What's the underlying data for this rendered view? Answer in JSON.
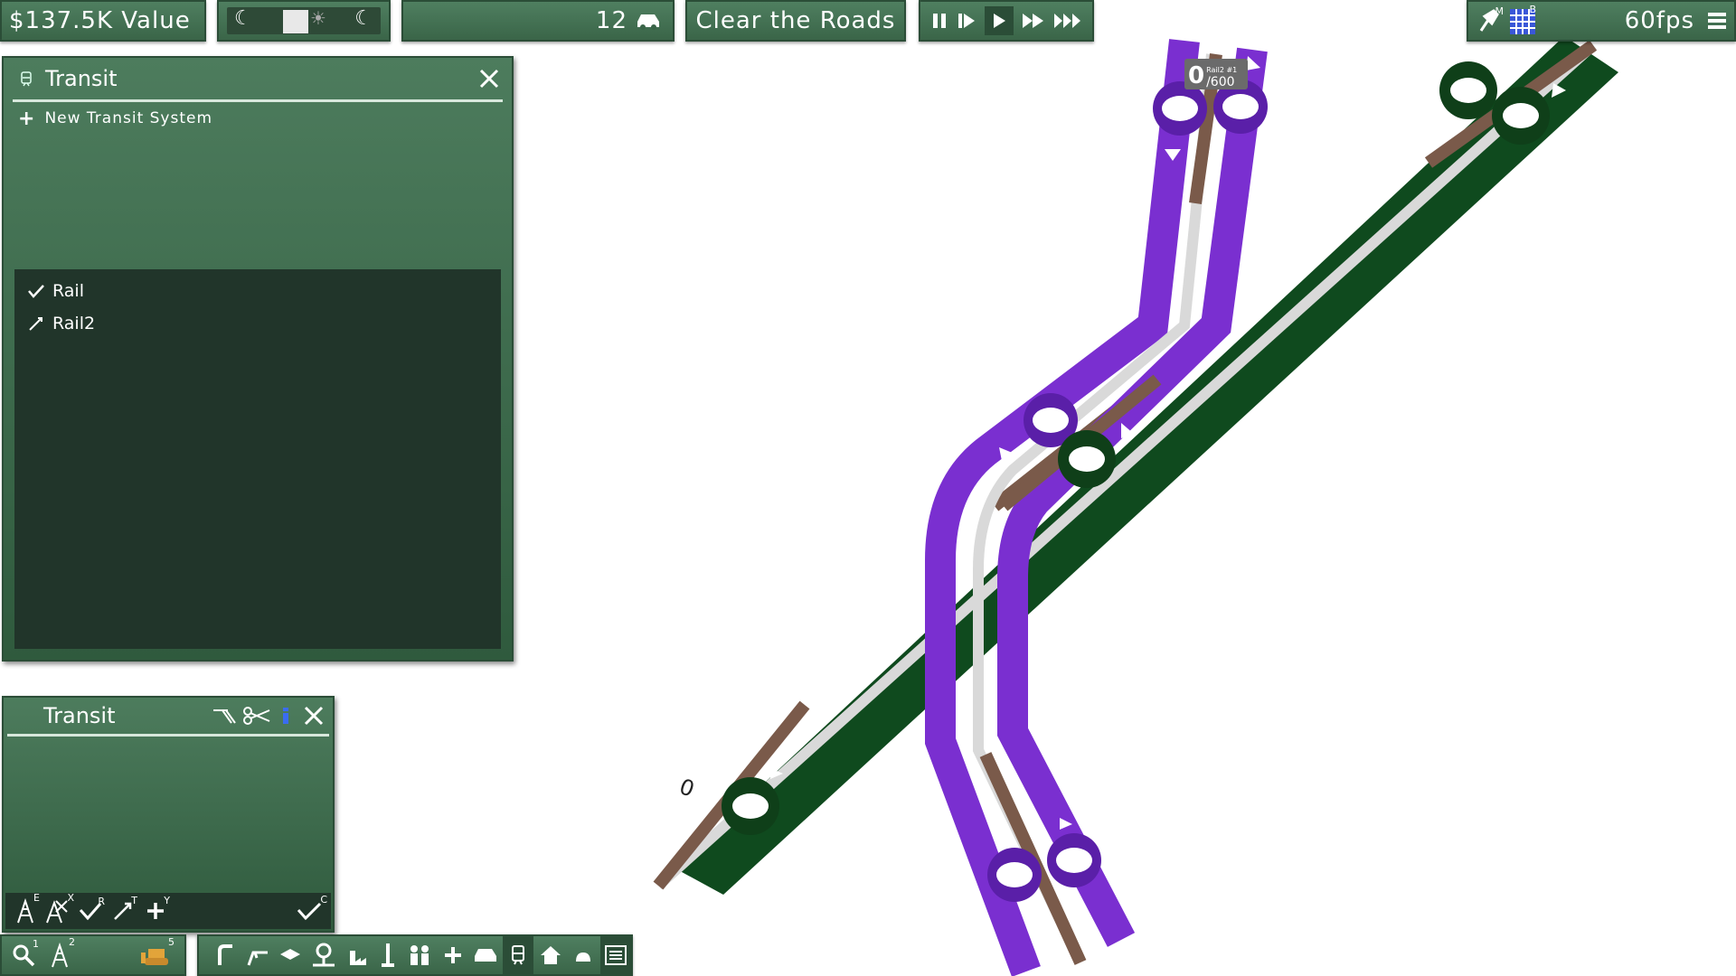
{
  "topbar": {
    "value_text": "$137.5K Value",
    "vehicle_count": "12",
    "clear_roads": "Clear the Roads",
    "fps": "60fps",
    "hotkeys": {
      "pin": "M",
      "grid": "B"
    }
  },
  "transit_panel": {
    "title": "Transit",
    "new_system": "New Transit System",
    "systems": [
      {
        "label": "Rail",
        "state": "check"
      },
      {
        "label": "Rail2",
        "state": "edit"
      }
    ]
  },
  "transit_tool": {
    "title": "Transit",
    "hotkeys": {
      "build": "E",
      "remove": "X",
      "done": "R",
      "edit": "T",
      "add": "Y",
      "confirm": "C"
    }
  },
  "bottom_left": {
    "hotkeys": {
      "search": "1",
      "road": "2",
      "bulldoze": "5"
    }
  },
  "map": {
    "stop_counter": "0",
    "counter_line": "Rail2 #1",
    "counter_capacity": "/600",
    "stop_label": "0",
    "colors": {
      "purple_line": "#7a2fd0",
      "green_line": "#0f4a1e",
      "rail": "#7a5a4a"
    }
  }
}
